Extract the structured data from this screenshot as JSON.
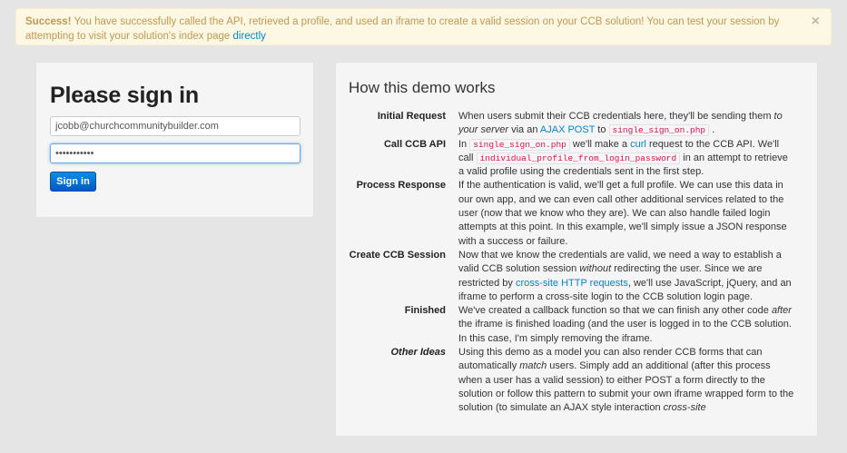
{
  "alert": {
    "strong": "Success!",
    "message": " You have successfully called the API, retrieved a profile, and used an iframe to create a valid session on your CCB solution! You can test your session by attempting to visit your solution's index page ",
    "link": "directly",
    "close": "×"
  },
  "signin": {
    "heading": "Please sign in",
    "email_value": "jcobb@churchcommunitybuilder.com",
    "password_value": "•••••••••••",
    "button": "Sign in"
  },
  "demo": {
    "heading": "How this demo works",
    "items": [
      {
        "term": "Initial Request",
        "parts": [
          "When users submit their CCB credentials here, they'll be sending them ",
          "to your server",
          " via an ",
          "AJAX POST",
          " to ",
          "single_sign_on.php",
          " ."
        ]
      },
      {
        "term": "Call CCB API",
        "parts": [
          "In ",
          "single_sign_on.php",
          " we'll make a ",
          "curl",
          " request to the CCB API. We'll call ",
          "individual_profile_from_login_password",
          " in an attempt to retrieve a valid profile using the credentials sent in the first step."
        ]
      },
      {
        "term": "Process Response",
        "parts": [
          "If the authentication is valid, we'll get a full profile. We can use this data in our own app, and we can even call other additional services related to the user (now that we know who they are). We can also handle failed login attempts at this point. In this example, we'll simply issue a JSON response with a success or failure."
        ]
      },
      {
        "term": "Create CCB Session",
        "parts": [
          "Now that we know the credentials are valid, we need a way to establish a valid CCB solution session ",
          "without",
          " redirecting the user. Since we are restricted by ",
          "cross-site HTTP requests",
          ", we'll use JavaScript, jQuery, and an iframe to perform a cross-site login to the CCB solution login page."
        ]
      },
      {
        "term": "Finished",
        "parts": [
          "We've created a callback function so that we can finish any other code ",
          "after",
          " the iframe is finished loading (and the user is logged in to the CCB solution. In this case, I'm simply removing the iframe."
        ]
      },
      {
        "term": "Other Ideas",
        "parts": [
          "Using this demo as a model you can also render CCB forms that can automatically ",
          "match",
          " users. Simply add an additional (after this process when a user has a valid session) to either POST a form directly to the solution or follow this pattern to submit your own iframe wrapped form to the solution (to simulate an AJAX style interaction ",
          "cross-site"
        ]
      }
    ]
  }
}
